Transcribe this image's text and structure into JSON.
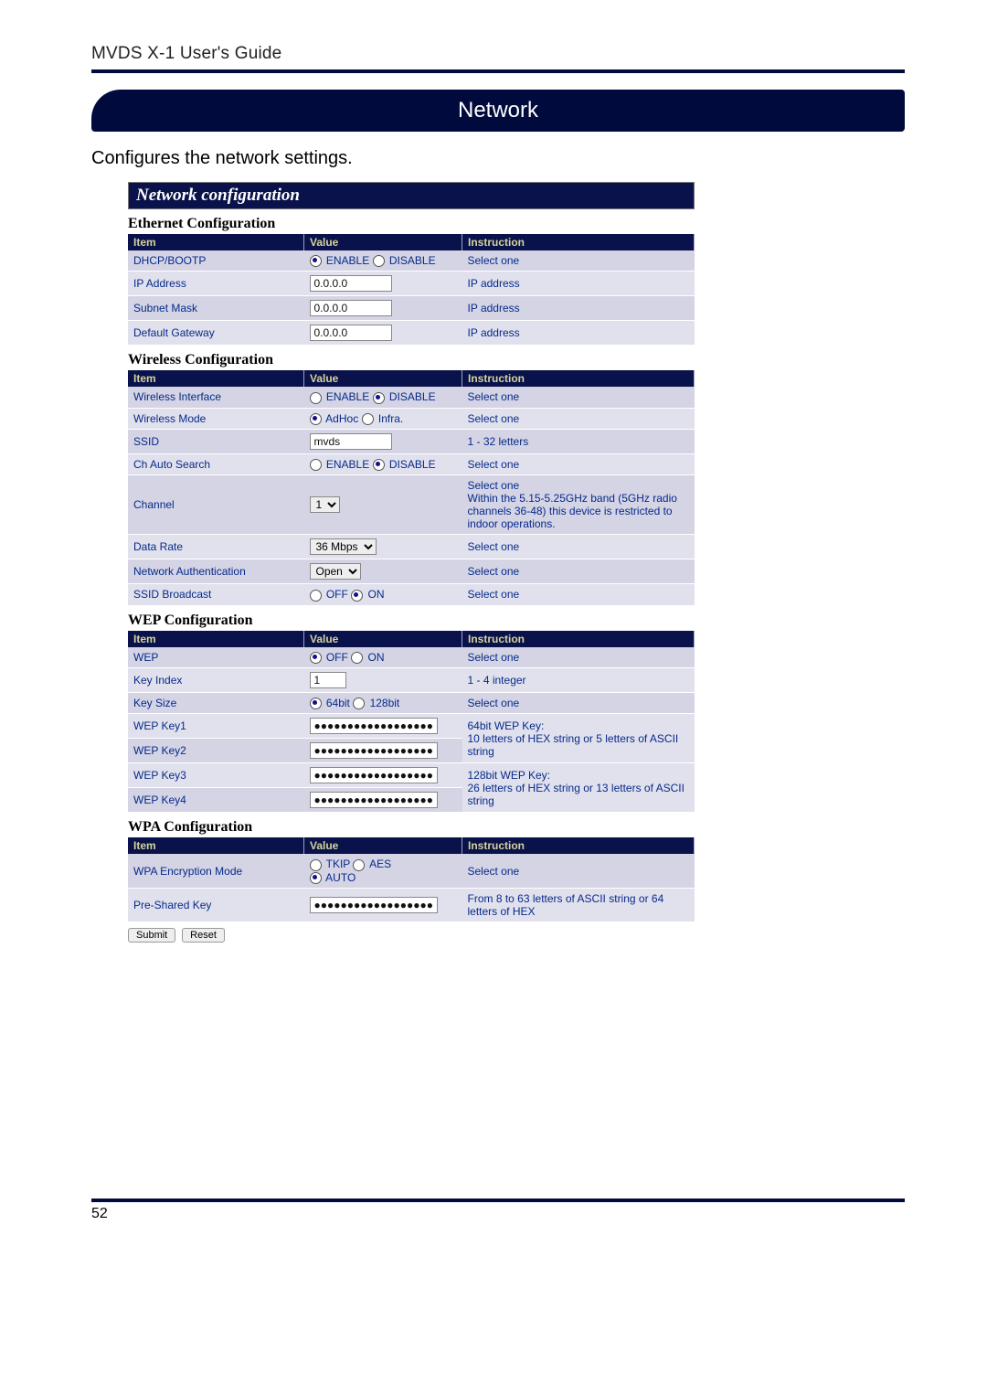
{
  "header": {
    "guide_title": "MVDS X-1 User's Guide"
  },
  "section": {
    "banner": "Network",
    "subtitle": "Configures the network settings."
  },
  "panel": {
    "title": "Network configuration"
  },
  "col": {
    "item": "Item",
    "value": "Value",
    "instruction": "Instruction"
  },
  "ethernet": {
    "title": "Ethernet Configuration",
    "rows": [
      {
        "item": "DHCP/BOOTP",
        "opt1": "ENABLE",
        "opt2": "DISABLE",
        "instruction": "Select one"
      },
      {
        "item": "IP Address",
        "value": "0.0.0.0",
        "instruction": "IP address"
      },
      {
        "item": "Subnet Mask",
        "value": "0.0.0.0",
        "instruction": "IP address"
      },
      {
        "item": "Default Gateway",
        "value": "0.0.0.0",
        "instruction": "IP address"
      }
    ]
  },
  "wireless": {
    "title": "Wireless Configuration",
    "rows": [
      {
        "item": "Wireless Interface",
        "opt1": "ENABLE",
        "opt2": "DISABLE",
        "instruction": "Select one"
      },
      {
        "item": "Wireless Mode",
        "opt1": "AdHoc",
        "opt2": "Infra.",
        "instruction": "Select one"
      },
      {
        "item": "SSID",
        "value": "mvds",
        "instruction": "1 - 32 letters"
      },
      {
        "item": "Ch Auto Search",
        "opt1": "ENABLE",
        "opt2": "DISABLE",
        "instruction": "Select one"
      },
      {
        "item": "Channel",
        "value": "1",
        "instruction": "Select one\nWithin the 5.15-5.25GHz band (5GHz radio channels 36-48) this device is restricted to indoor operations."
      },
      {
        "item": "Data Rate",
        "value": "36 Mbps",
        "instruction": "Select one"
      },
      {
        "item": "Network Authentication",
        "value": "Open",
        "instruction": "Select one"
      },
      {
        "item": "SSID Broadcast",
        "opt1": "OFF",
        "opt2": "ON",
        "instruction": "Select one"
      }
    ]
  },
  "wep": {
    "title": "WEP Configuration",
    "rows": [
      {
        "item": "WEP",
        "opt1": "OFF",
        "opt2": "ON",
        "instruction": "Select one"
      },
      {
        "item": "Key Index",
        "value": "1",
        "instruction": "1 - 4 integer"
      },
      {
        "item": "Key Size",
        "opt1": "64bit",
        "opt2": "128bit",
        "instruction": "Select one"
      },
      {
        "item": "WEP Key1",
        "instruction": "64bit WEP Key:\n10 letters of HEX string or 5 letters of ASCII string"
      },
      {
        "item": "WEP Key2",
        "instruction": ""
      },
      {
        "item": "WEP Key3",
        "instruction": "128bit WEP Key:\n26 letters of HEX string or 13 letters of ASCII string"
      },
      {
        "item": "WEP Key4",
        "instruction": ""
      }
    ]
  },
  "wpa": {
    "title": "WPA Configuration",
    "rows": [
      {
        "item": "WPA Encryption Mode",
        "opt1": "TKIP",
        "opt2": "AES",
        "opt3": "AUTO",
        "instruction": "Select one"
      },
      {
        "item": "Pre-Shared Key",
        "instruction": "From 8 to 63 letters of ASCII string or 64 letters of HEX"
      }
    ],
    "submit": "Submit",
    "reset": "Reset"
  },
  "dots": "●●●●●●●●●●●●●●●●●●",
  "page_number": "52"
}
